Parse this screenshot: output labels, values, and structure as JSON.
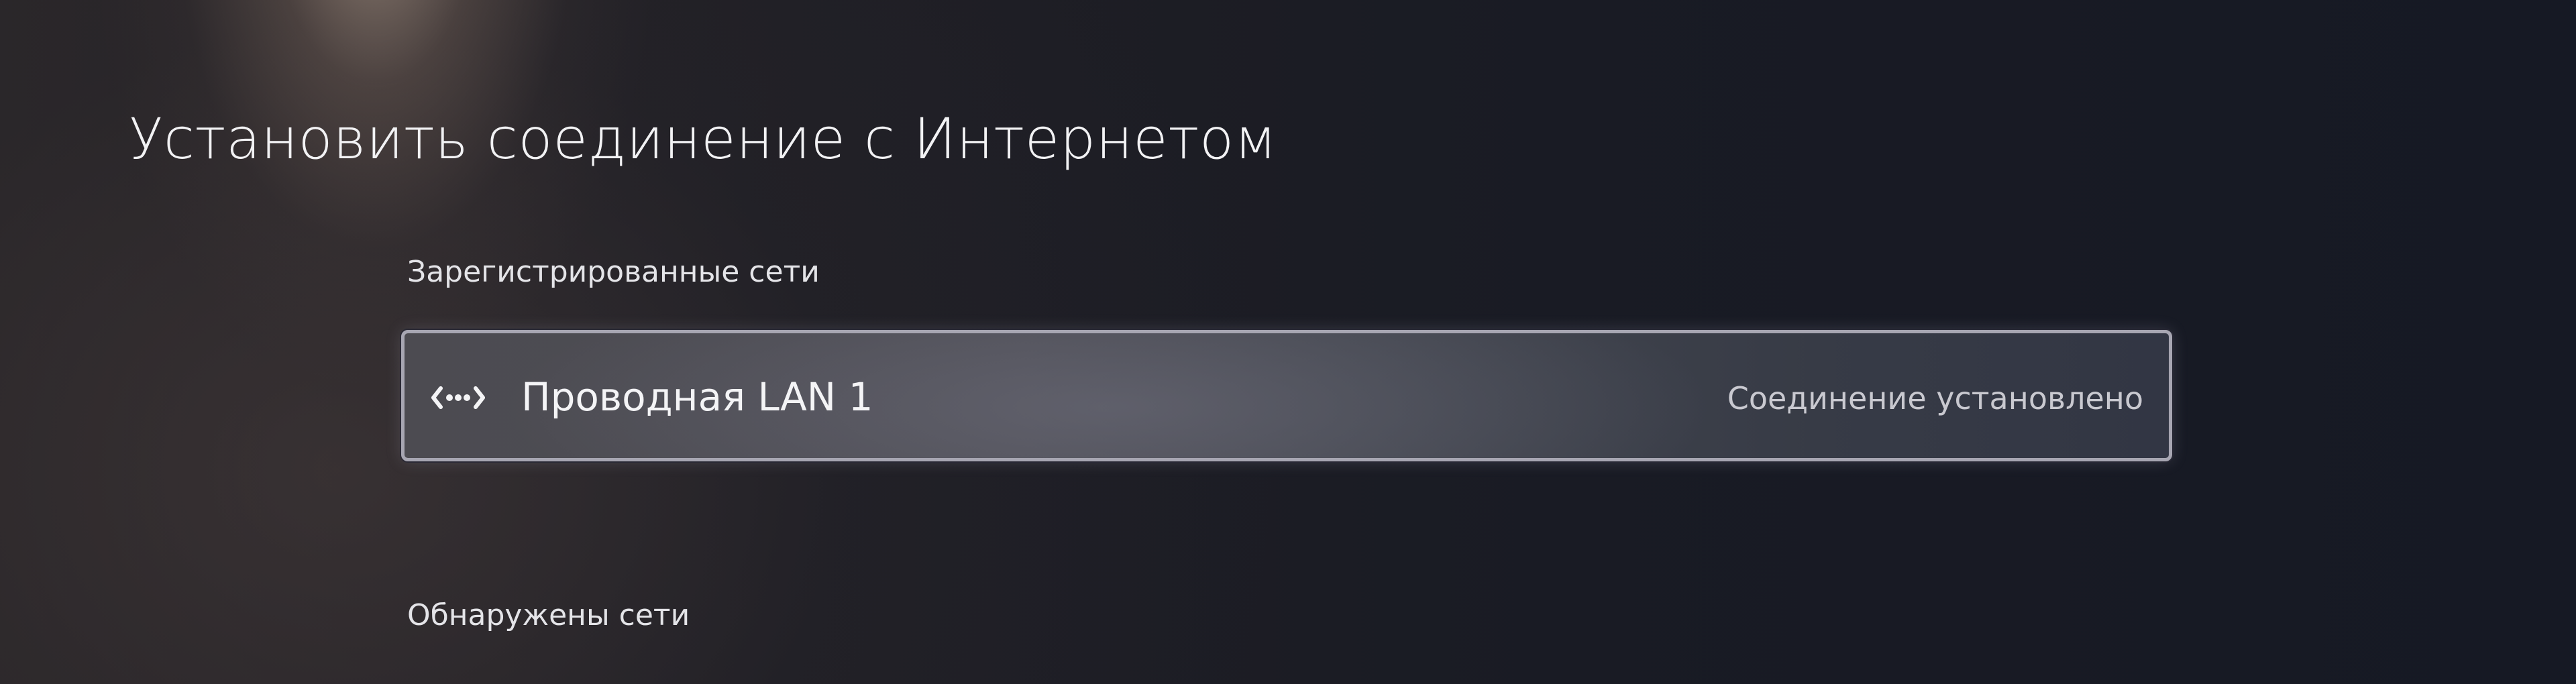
{
  "page": {
    "title": "Установить соединение с Интернетом"
  },
  "registered_networks": {
    "heading": "Зарегистрированные сети",
    "items": [
      {
        "icon": "wired-lan-icon",
        "name": "Проводная LAN 1",
        "status": "Соединение установлено"
      }
    ]
  },
  "found_networks": {
    "heading": "Обнаружены сети"
  },
  "colors": {
    "focus_border": "#a7a6b2",
    "text_primary": "#f4f4f6",
    "text_secondary": "#c9c9d0"
  }
}
